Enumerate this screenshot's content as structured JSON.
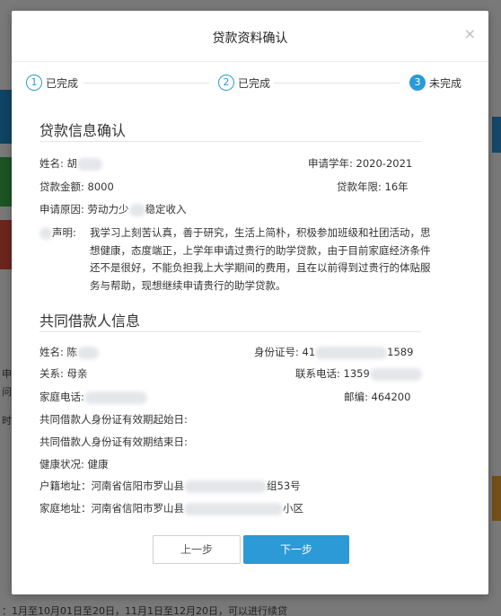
{
  "dialog": {
    "title": "贷款资料确认",
    "close_glyph": "×"
  },
  "steps": [
    {
      "num": "1",
      "label": "已完成"
    },
    {
      "num": "2",
      "label": "已完成"
    },
    {
      "num": "3",
      "label": "未完成"
    }
  ],
  "loan_info": {
    "section_title": "贷款信息确认",
    "name_label": "姓名: 胡",
    "year_label": "申请学年: 2020-2021",
    "amount_label": "贷款金额: 8000",
    "term_label": "贷款年限: 16年",
    "reason_prefix": "申请原因: 劳动力少",
    "reason_suffix": "稳定收入",
    "statement_label": "声明:",
    "statement_text": "我学习上刻苦认真，善于研究，生活上简朴，积极参加班级和社团活动，思想健康，态度端正，上学年申请过贵行的助学贷款，由于目前家庭经济条件还不是很好，不能负担我上大学期间的费用，且在以前得到过贵行的体贴服务与帮助，现想继续申请贵行的助学贷款。"
  },
  "co_borrower": {
    "section_title": "共同借款人信息",
    "name_label": "姓名: 陈",
    "id_prefix": "身份证号: 41",
    "id_suffix": "1589",
    "relation_label": "关系: 母亲",
    "phone_label": "联系电话: 1359",
    "home_phone_label": "家庭电话:",
    "postcode_label": "邮编: 464200",
    "id_start_label": "共同借款人身份证有效期起始日:",
    "id_end_label": "共同借款人身份证有效期结束日:",
    "health_label": "健康状况: 健康",
    "hukou_prefix": "户籍地址：河南省信阳市罗山县",
    "hukou_suffix": "组53号",
    "home_addr_prefix": "家庭地址：河南省信阳市罗山县",
    "home_addr_suffix": "小区"
  },
  "buttons": {
    "prev": "上一步",
    "next": "下一步"
  },
  "background": {
    "left_snippets": [
      "申",
      "问",
      "时"
    ],
    "bottom_snippet": "：1月至10月01日至20日，11月1日至12月20日，可以进行续贷"
  },
  "colors": {
    "accent": "#2c9ad6",
    "overlay": "rgba(0,0,0,0.5)"
  }
}
